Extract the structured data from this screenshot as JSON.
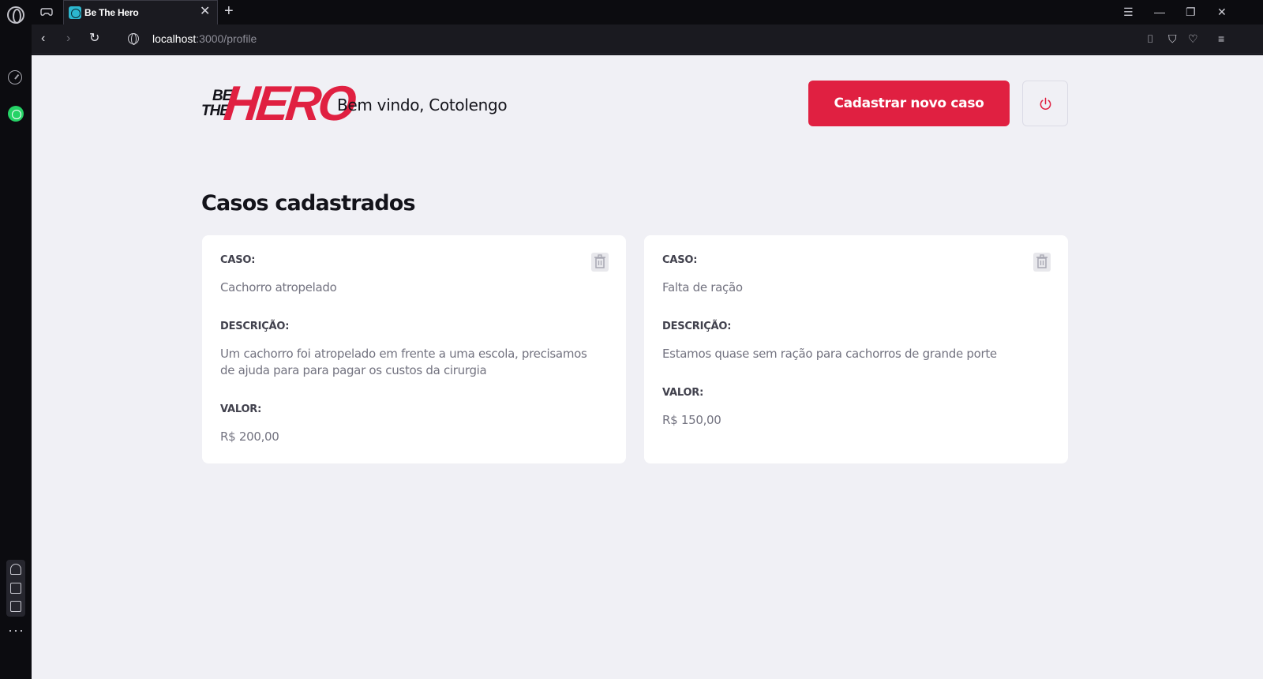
{
  "browser": {
    "tab_title": "Be The Hero",
    "url_host": "localhost",
    "url_path": ":3000/profile"
  },
  "app": {
    "logo_small_1": "BE",
    "logo_small_2": "THE",
    "logo_big": "HERO",
    "welcome": "Bem vindo, Cotolengo",
    "new_case_button": "Cadastrar novo caso",
    "section_title": "Casos cadastrados",
    "accent_color": "#e02041"
  },
  "cases": [
    {
      "case_label": "CASO:",
      "case_value": "Cachorro atropelado",
      "desc_label": "DESCRIÇÃO:",
      "desc_value": "Um cachorro foi atropelado em frente a uma escola, precisamos de ajuda para para pagar os custos da cirurgia",
      "value_label": "VALOR:",
      "value_value": "R$ 200,00"
    },
    {
      "case_label": "CASO:",
      "case_value": "Falta de ração",
      "desc_label": "DESCRIÇÃO:",
      "desc_value": "Estamos quase sem ração para cachorros de grande porte",
      "value_label": "VALOR:",
      "value_value": "R$ 150,00"
    }
  ]
}
